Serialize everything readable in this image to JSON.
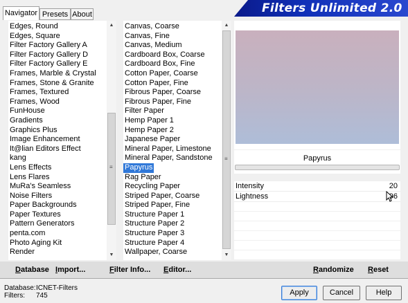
{
  "tabs": [
    "Navigator",
    "Presets",
    "About"
  ],
  "banner_title": "Filters Unlimited 2.0",
  "categories": [
    "Edges, Round",
    "Edges, Square",
    "Filter Factory Gallery A",
    "Filter Factory Gallery D",
    "Filter Factory Gallery E",
    "Frames, Marble & Crystal",
    "Frames, Stone & Granite",
    "Frames, Textured",
    "Frames, Wood",
    "FunHouse",
    "Gradients",
    "Graphics Plus",
    "Image Enhancement",
    "It@lian Editors Effect",
    "kang",
    "Lens Effects",
    "Lens Flares",
    "MuRa's Seamless",
    "Noise Filters",
    "Paper Backgrounds",
    "Paper Textures",
    "Pattern Generators",
    "penta.com",
    "Photo Aging Kit",
    "Render"
  ],
  "filters": [
    "Canvas, Coarse",
    "Canvas, Fine",
    "Canvas, Medium",
    "Cardboard Box, Coarse",
    "Cardboard Box, Fine",
    "Cotton Paper, Coarse",
    "Cotton Paper, Fine",
    "Fibrous Paper, Coarse",
    "Fibrous Paper, Fine",
    "Filter Paper",
    "Hemp Paper 1",
    "Hemp Paper 2",
    "Japanese Paper",
    "Mineral Paper, Limestone",
    "Mineral Paper, Sandstone",
    "Papyrus",
    "Rag Paper",
    "Recycling Paper",
    "Striped Paper, Coarse",
    "Striped Paper, Fine",
    "Structure Paper 1",
    "Structure Paper 2",
    "Structure Paper 3",
    "Structure Paper 4",
    "Wallpaper, Coarse"
  ],
  "selected_filter_index": 15,
  "filter_name": "Papyrus",
  "params": [
    {
      "label": "Intensity",
      "value": "20"
    },
    {
      "label": "Lightness",
      "value": "96"
    }
  ],
  "actions": {
    "database": "Database",
    "import": "Import...",
    "filter_info": "Filter Info...",
    "editor": "Editor...",
    "randomize": "Randomize",
    "reset": "Reset"
  },
  "info": {
    "database_label": "Database:",
    "database_value": "ICNET-Filters",
    "filters_label": "Filters:",
    "filters_value": "745"
  },
  "buttons": {
    "apply": "Apply",
    "cancel": "Cancel",
    "help": "Help"
  }
}
